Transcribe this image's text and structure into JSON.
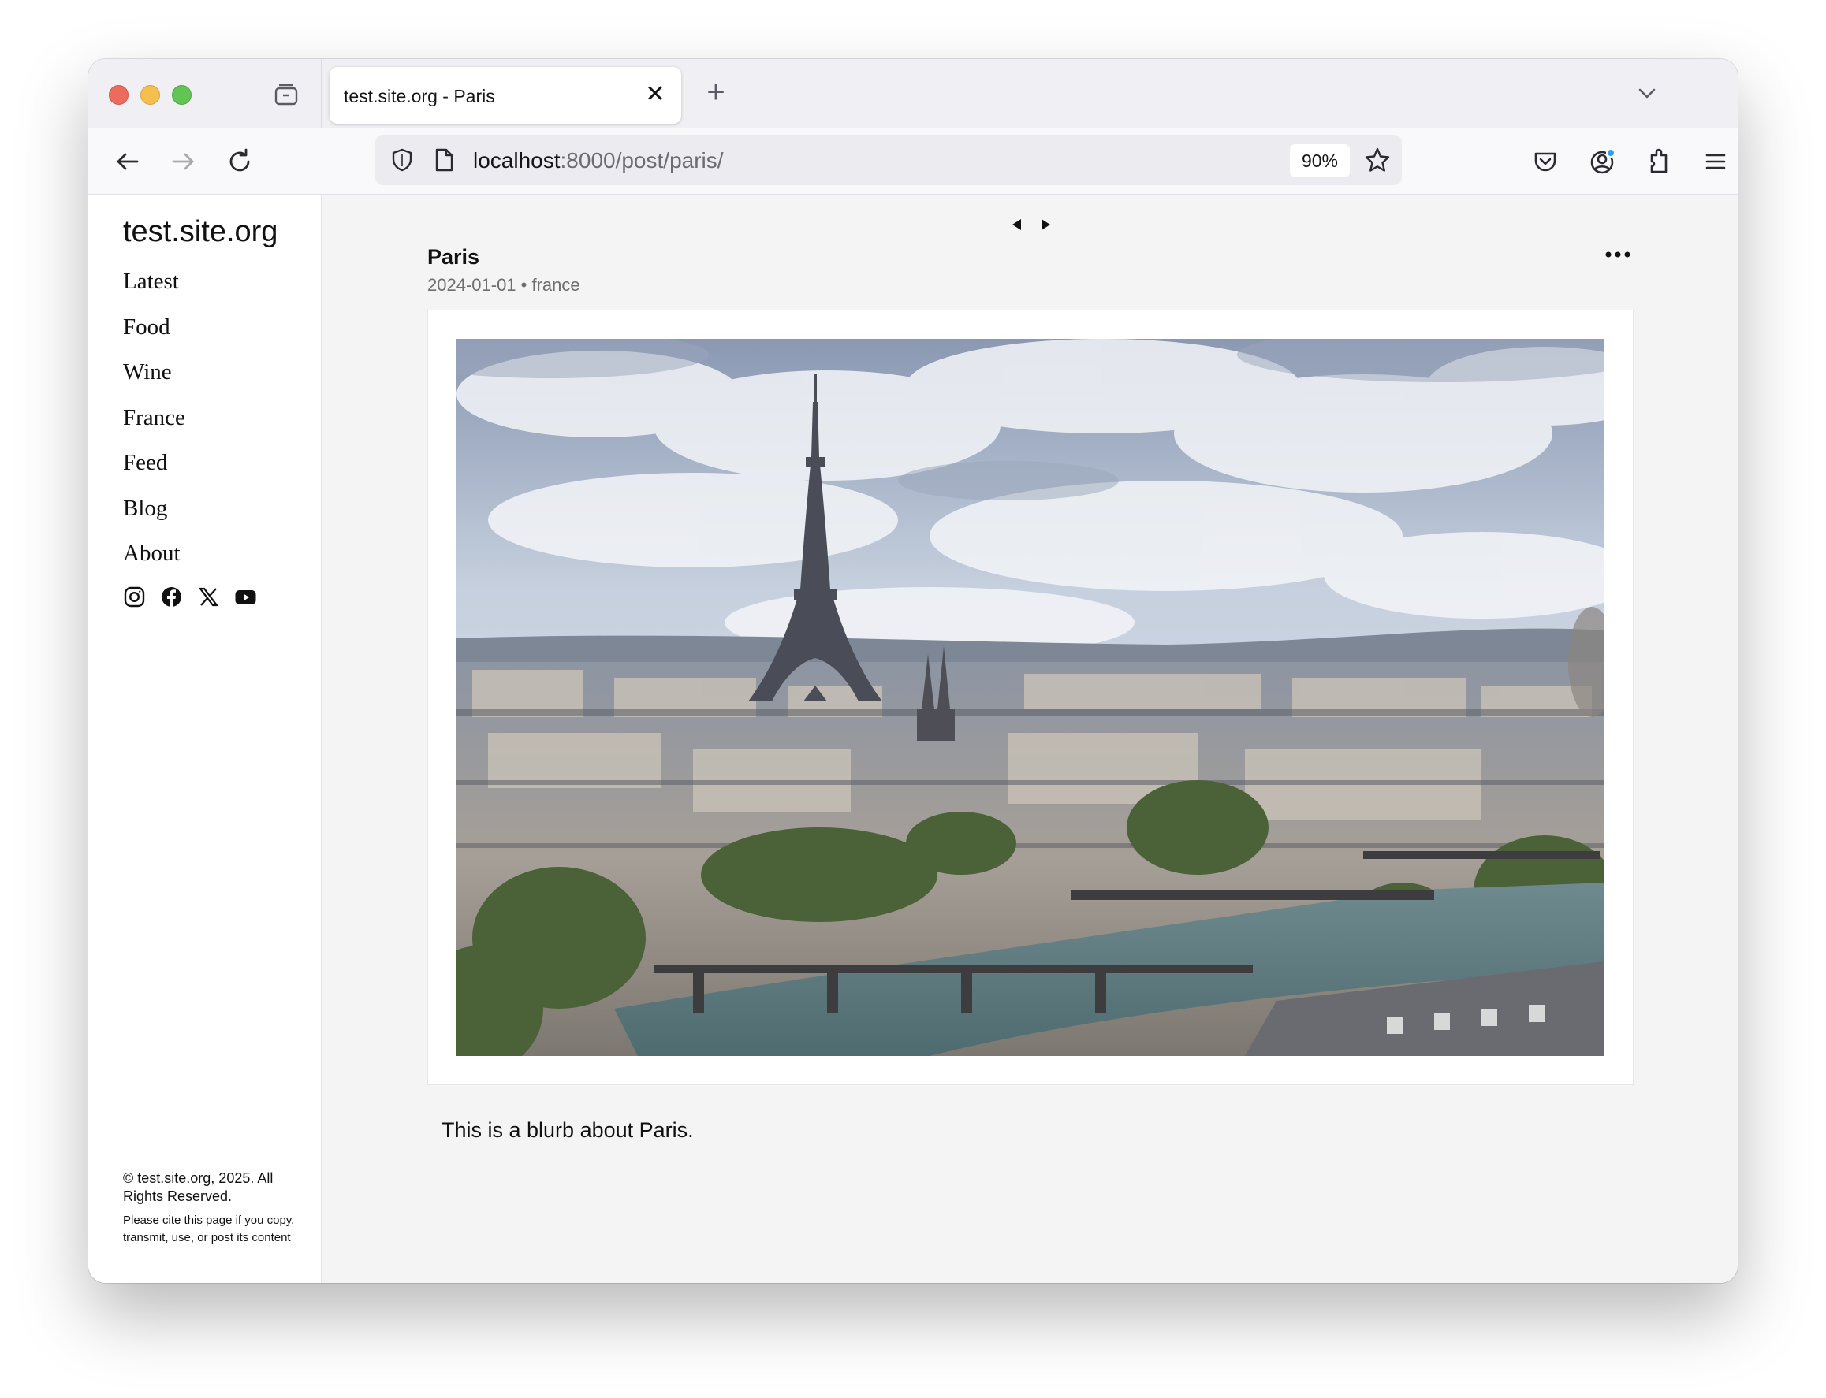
{
  "browser": {
    "tab": {
      "title": "test.site.org - Paris",
      "close_glyph": "✕"
    },
    "new_tab_glyph": "+",
    "url": {
      "host": "localhost",
      "rest": ":8000/post/paris/"
    },
    "zoom": "90%",
    "icons": {
      "tab_overview": "tab-overview-icon",
      "back": "back-arrow-icon",
      "forward": "forward-arrow-icon",
      "reload": "reload-icon",
      "shield": "tracking-protection-shield-icon",
      "page": "page-info-icon",
      "bookmark": "bookmark-star-icon",
      "pocket": "pocket-icon",
      "account": "account-icon",
      "extensions": "extensions-icon",
      "menu": "hamburger-menu-icon",
      "tab_list": "chevron-down-icon"
    }
  },
  "site": {
    "title": "test.site.org",
    "nav": [
      {
        "label": "Latest"
      },
      {
        "label": "Food"
      },
      {
        "label": "Wine"
      },
      {
        "label": "France"
      },
      {
        "label": "Feed"
      },
      {
        "label": "Blog"
      },
      {
        "label": "About"
      }
    ],
    "social": [
      "instagram-icon",
      "facebook-icon",
      "x-icon",
      "youtube-icon"
    ],
    "footer": {
      "copyright": "© test.site.org, 2025. All Rights Reserved.",
      "note": "Please cite this page if you copy, transmit, use, or post its content"
    }
  },
  "post": {
    "title": "Paris",
    "meta": "2024-01-01 • france",
    "blurb": "This is a blurb about Paris.",
    "image_subject": "paris-eiffel-tower-seine-photo"
  },
  "colors": {
    "traffic_red": "#ed6a5e",
    "traffic_yellow": "#f5bf4f",
    "traffic_green": "#61c554",
    "account_badge": "#2f9cf5"
  }
}
